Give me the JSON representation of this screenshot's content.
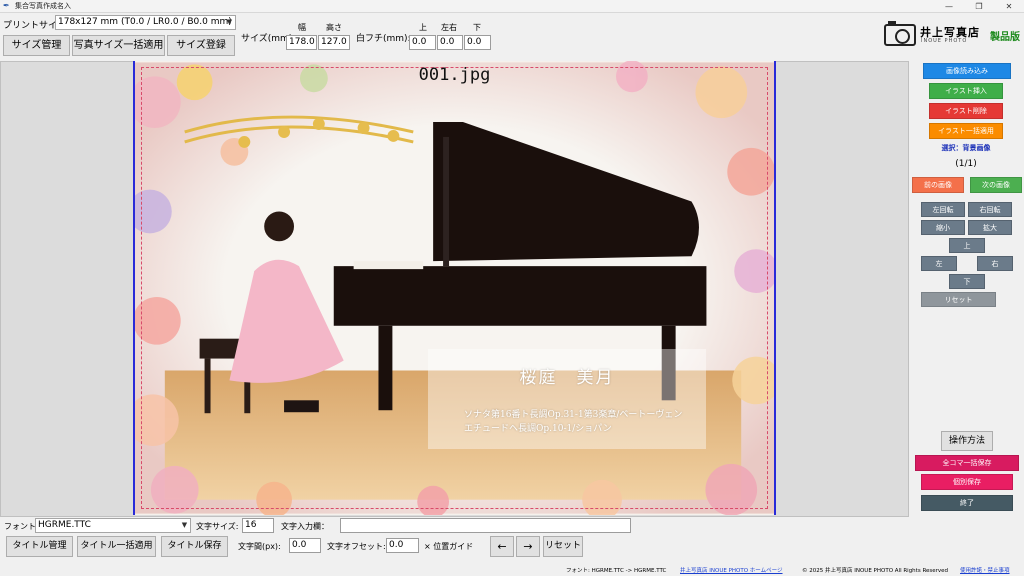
{
  "window": {
    "title": "集合写真作成名入",
    "controls": [
      "—",
      "❐",
      "✕"
    ]
  },
  "top": {
    "print_size_label": "プリントサイズ:",
    "print_size_value": "178x127 mm (T0.0 / LR0.0 / B0.0 mm)",
    "size_manage": "サイズ管理",
    "bulk_apply": "写真サイズ一括適用",
    "size_register": "サイズ登録",
    "size_mm_label": "サイズ(mm):",
    "width_label": "幅",
    "height_label": "高さ",
    "width_value": "178.0",
    "height_value": "127.0",
    "border_label": "白フチ(mm):",
    "border_top_label": "上",
    "border_lr_label": "左右",
    "border_bottom_label": "下",
    "border_top": "0.0",
    "border_lr": "0.0",
    "border_bottom": "0.0"
  },
  "logo": {
    "shop_name": "井上写真店",
    "sub": "INOUE PHOTO",
    "edition": "製品版"
  },
  "canvas": {
    "filename": "001.jpg",
    "name": "桜庭　美月",
    "line1": "ソナタ第16番ト長調Op.31-1第3楽章/ベートーヴェン",
    "line2": "エチュードヘ長調Op.10-1/ショパン"
  },
  "right": {
    "load_image": "画像読み込み",
    "insert_illust": "イラスト挿入",
    "delete_illust": "イラスト削除",
    "bulk_illust": "イラスト一括適用",
    "selection": "選択：背景画像",
    "page": "(1/1)",
    "prev": "前の画像",
    "next": "次の画像",
    "rotate_left": "左回転",
    "rotate_right": "右回転",
    "shrink": "縮小",
    "enlarge": "拡大",
    "up": "上",
    "left": "左",
    "right": "右",
    "down": "下",
    "reset": "リセット",
    "howto": "操作方法",
    "save_all": "全コマ一括保存",
    "save_each": "個別保存",
    "exit": "終了"
  },
  "bottom": {
    "font_label": "フォント:",
    "font_value": "HGRME.TTC",
    "font_size_label": "文字サイズ:",
    "font_size_value": "16",
    "text_input_label": "文字入力欄：",
    "text_input_value": "",
    "title_manage": "タイトル管理",
    "title_bulk": "タイトル一括適用",
    "title_save": "タイトル保存",
    "char_spacing_label": "文字間(px):",
    "char_spacing_value": "0.0",
    "text_offset_label": "文字オフセット:",
    "text_offset_value": "0.0",
    "pos_guide": "× 位置ガイド",
    "arrow_left": "←",
    "arrow_right": "→",
    "reset": "リセット"
  },
  "status": {
    "font_info": "フォント: HGRME.TTC -> HGRME.TTC",
    "homepage_link": "井上写真店 INOUE PHOTO ホームページ",
    "copyright": "© 2025 井上写真店 INOUE PHOTO All Rights Reserved",
    "terms_link": "使用許諾・禁止事項"
  },
  "colors": {
    "blue": "#1e88e5",
    "green": "#3fae49",
    "red": "#e53935",
    "orange": "#fb8c00",
    "prev": "#f4704a",
    "next": "#4caf50",
    "magenta": "#d81b60",
    "pink": "#e91e63",
    "slate": "#455a64"
  }
}
